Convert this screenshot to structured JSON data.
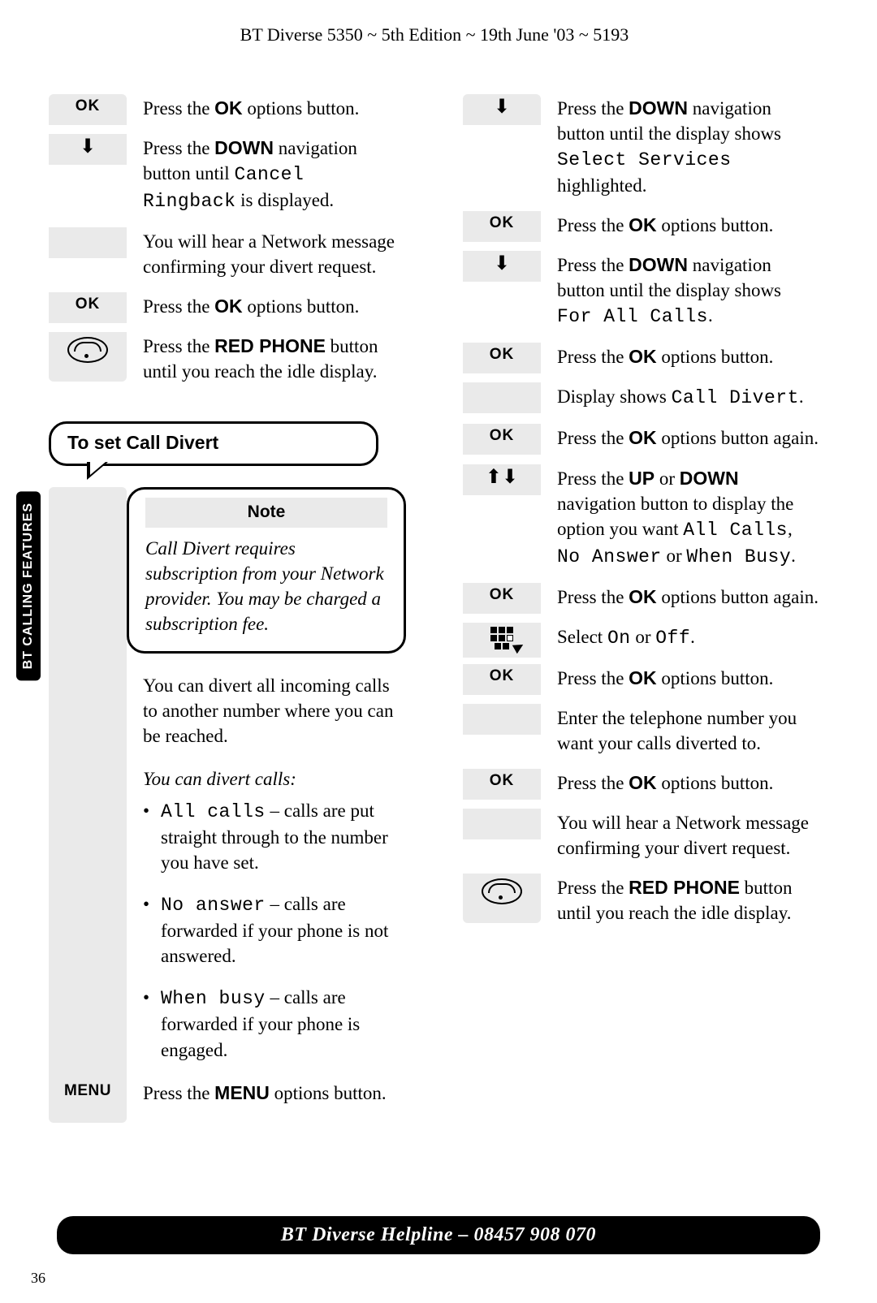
{
  "header": "BT Diverse 5350 ~ 5th Edition ~ 19th June '03 ~ 5193",
  "side_tab": "BT CALLING FEATURES",
  "labels": {
    "ok": "OK",
    "menu": "MENU",
    "note_title": "Note"
  },
  "left": {
    "s1": {
      "pre": "Press the ",
      "bold": "OK",
      "post": " options button."
    },
    "s2": {
      "pre": "Press the ",
      "bold": "DOWN",
      "mid": " navigation button until ",
      "lcd": "Cancel Ringback",
      "post": " is displayed."
    },
    "s3": "You will hear a Network message confirming your divert request.",
    "s4": {
      "pre": "Press the ",
      "bold": "OK",
      "post": " options button."
    },
    "s5": {
      "pre": "Press the ",
      "bold": "RED PHONE",
      "post": " button until you reach the idle display."
    },
    "callout": "To set Call Divert",
    "note_body": "Call Divert requires subscription from your Network provider. You may be charged a subscription fee.",
    "intro": "You can divert all incoming calls to another number where you can be reached.",
    "divert_heading": "You can divert calls:",
    "opts": [
      {
        "lcd": "All calls",
        "txt": " – calls are put straight through to the number you have set."
      },
      {
        "lcd": "No answer",
        "txt": " – calls are forwarded if your phone is not answered."
      },
      {
        "lcd": "When busy",
        "txt": " – calls are forwarded if your phone is engaged."
      }
    ],
    "menu_step": {
      "pre": "Press the ",
      "bold": "MENU",
      "post": " options button."
    }
  },
  "right": {
    "s1": {
      "pre": "Press the ",
      "bold": "DOWN",
      "mid": " navigation button until the display shows ",
      "lcd": "Select Services",
      "post": " highlighted."
    },
    "s2": {
      "pre": "Press the ",
      "bold": "OK",
      "post": " options button."
    },
    "s3": {
      "pre": "Press the ",
      "bold": "DOWN",
      "mid": " navigation button until the display shows ",
      "lcd": "For All Calls",
      "post": "."
    },
    "s4": {
      "pre": "Press the ",
      "bold": "OK",
      "post": " options button."
    },
    "s5": {
      "pre": "Display shows ",
      "lcd": "Call Divert",
      "post": "."
    },
    "s6": {
      "pre": "Press the ",
      "bold": "OK",
      "post": " options button again."
    },
    "s7": {
      "pre": "Press the ",
      "bold1": "UP",
      "mid1": " or ",
      "bold2": "DOWN",
      "mid2": " navigation button to display the option you want ",
      "lcd1": "All Calls",
      "c1": ", ",
      "lcd2": "No Answer",
      "c2": " or ",
      "lcd3": "When Busy",
      "post": "."
    },
    "s8": {
      "pre": "Press the ",
      "bold": "OK",
      "post": " options button again."
    },
    "s9": {
      "pre": "Select ",
      "lcd1": "On",
      "mid": " or ",
      "lcd2": "Off",
      "post": "."
    },
    "s10": {
      "pre": "Press the ",
      "bold": "OK",
      "post": " options button."
    },
    "s11": "Enter the telephone number you want your calls diverted to.",
    "s12": {
      "pre": "Press the ",
      "bold": "OK",
      "post": " options button."
    },
    "s13": "You will hear a Network message confirming your divert request.",
    "s14": {
      "pre": "Press the ",
      "bold": "RED PHONE",
      "post": " button until you reach the idle display."
    }
  },
  "helpline": "BT Diverse Helpline – 08457 908 070",
  "page_num": "36"
}
